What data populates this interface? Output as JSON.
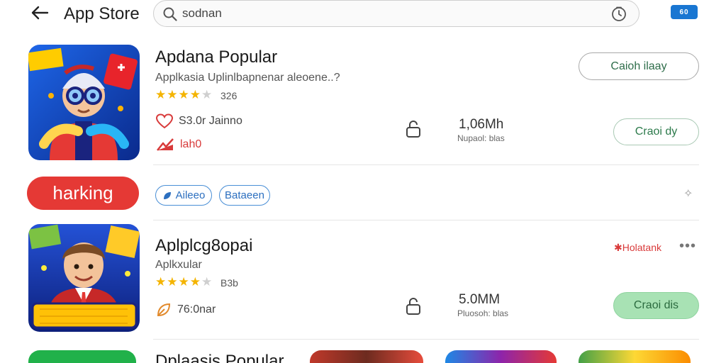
{
  "header": {
    "title": "App Store",
    "search_value": "sodnan",
    "battery_label": "60"
  },
  "apps": [
    {
      "name": "Apdana Popular",
      "subtitle": "Applkasia Uplinlbapnenar aleoene..?",
      "rating_count": "326",
      "stars": 4,
      "meta_label": "S3.0r Jainno",
      "trend_label": "lah0",
      "size": "1,06Mh",
      "size_label": "Nupaol: blas",
      "primary_button": "Caioh ilaay",
      "secondary_button": "Craoi dy"
    },
    {
      "name": "Aplplcg8opai",
      "subtitle": "Aplkxular",
      "rating_count": "B3b",
      "stars": 4,
      "meta_label": "76:0nar",
      "size": "5.0MM",
      "size_label": "Pluosoh: blas",
      "badge": "Holatank",
      "install_button": "Craoi dis"
    }
  ],
  "tags": {
    "ranking": "harking",
    "chip1": "Aileeo",
    "chip2": "Bataeen"
  },
  "bottom_partial_title": "Dplaasis Popular",
  "colors": {
    "accent_red": "#e53935",
    "star": "#f4b400",
    "chip_blue": "#4a8fd6",
    "install_green": "#a8e2b4"
  },
  "icons": [
    "back-arrow-icon",
    "search-icon",
    "mic-icon",
    "battery-icon",
    "heart-icon",
    "trend-icon",
    "lock-icon",
    "sparkle-icon",
    "more-icon",
    "leaf-icon"
  ]
}
